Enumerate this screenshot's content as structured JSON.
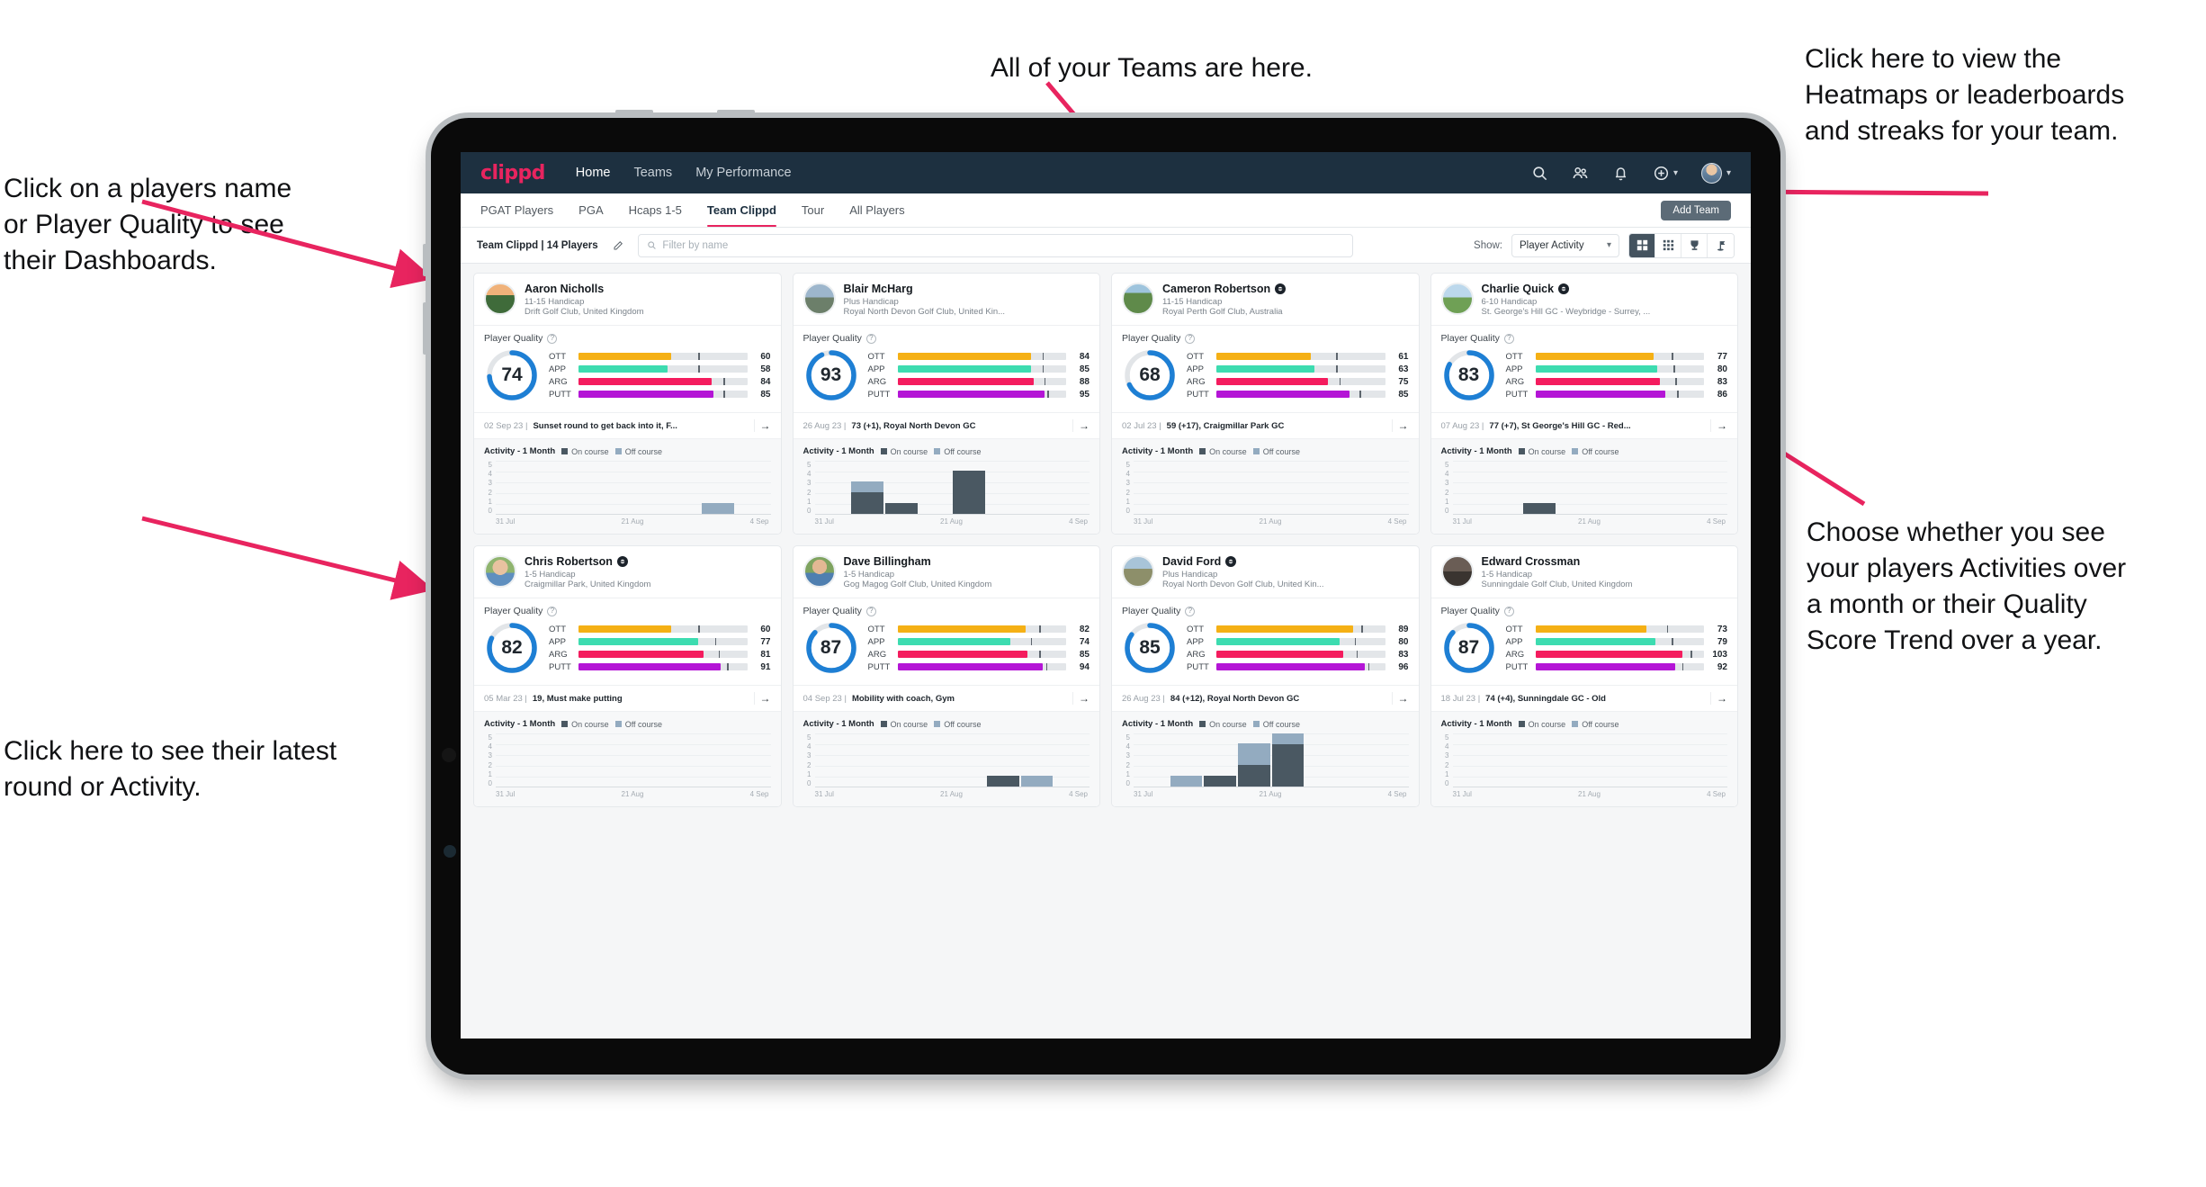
{
  "annotations": [
    {
      "id": "teams",
      "text": "All of your Teams are here."
    },
    {
      "id": "heatmaps",
      "text": "Click here to view the\nHeatmaps or leaderboards\nand streaks for your team."
    },
    {
      "id": "players-name",
      "text": "Click on a players name\nor Player Quality to see\ntheir Dashboards."
    },
    {
      "id": "activity-choice",
      "text": "Choose whether you see\nyour players Activities over\na month or their Quality\nScore Trend over a year."
    },
    {
      "id": "latest-round",
      "text": "Click here to see their latest\nround or Activity."
    }
  ],
  "app": {
    "brand": "clippd",
    "nav_links": [
      {
        "label": "Home",
        "active": true
      },
      {
        "label": "Teams",
        "active": false
      },
      {
        "label": "My Performance",
        "active": false
      }
    ],
    "nav_icons": [
      "search-icon",
      "people-icon",
      "bell-icon",
      "plus-circle-icon",
      "avatar"
    ],
    "tabs": [
      {
        "label": "PGAT Players",
        "active": false
      },
      {
        "label": "PGA",
        "active": false
      },
      {
        "label": "Hcaps 1-5",
        "active": false
      },
      {
        "label": "Team Clippd",
        "active": true
      },
      {
        "label": "Tour",
        "active": false
      },
      {
        "label": "All Players",
        "active": false
      }
    ],
    "add_team_label": "Add Team",
    "filter": {
      "team_label": "Team Clippd | 14 Players",
      "edit_icon": "pencil-icon",
      "search_placeholder": "Filter by name",
      "search_value": "",
      "show_label": "Show:",
      "show_value": "Player Activity",
      "show_options": [
        "Player Activity",
        "Quality Score Trend"
      ],
      "view_toggles": [
        {
          "name": "grid-view-icon",
          "active": true
        },
        {
          "name": "dense-grid-view-icon",
          "active": false
        },
        {
          "name": "trophy-leaderboard-icon",
          "active": false
        },
        {
          "name": "heatmap-flag-icon",
          "active": false
        }
      ]
    },
    "card_labels": {
      "quality_title": "Player Quality",
      "activity_title": "Activity - 1 Month",
      "legend_on": "On course",
      "legend_off": "Off course",
      "metric_names": [
        "OTT",
        "APP",
        "ARG",
        "PUTT"
      ],
      "y_ticks": [
        "5",
        "4",
        "3",
        "2",
        "1",
        "0"
      ],
      "x_ticks": [
        "31 Jul",
        "21 Aug",
        "4 Sep"
      ],
      "arrow": "→"
    },
    "colors": {
      "brand_pink": "#e8245f",
      "navbar": "#1d3040",
      "ott": "#f5b015",
      "app": "#3ddcb0",
      "arg": "#f41c5e",
      "putt": "#b415d6",
      "donut": "#1e7fd4",
      "on_course": "#4a5862",
      "off_course": "#93abc0"
    }
  },
  "players": [
    {
      "name": "Aaron Nicholls",
      "verified": false,
      "handicap": "11-15 Handicap",
      "club": "Drift Golf Club, United Kingdom",
      "quality_score": 74,
      "metrics": [
        {
          "label": "OTT",
          "value": 60,
          "fill": 55,
          "tick": 71,
          "color": "#f5b015"
        },
        {
          "label": "APP",
          "value": 58,
          "fill": 53,
          "tick": 71,
          "color": "#3ddcb0"
        },
        {
          "label": "ARG",
          "value": 84,
          "fill": 79,
          "tick": 86,
          "color": "#f41c5e"
        },
        {
          "label": "PUTT",
          "value": 85,
          "fill": 80,
          "tick": 86,
          "color": "#b415d6"
        }
      ],
      "latest_date": "02 Sep 23",
      "latest_text": "Sunset round to get back into it, F...",
      "activity": [
        {
          "on": 0,
          "off": 0
        },
        {
          "on": 0,
          "off": 0
        },
        {
          "on": 0,
          "off": 0
        },
        {
          "on": 0,
          "off": 0
        },
        {
          "on": 0,
          "off": 0
        },
        {
          "on": 0,
          "off": 0
        },
        {
          "on": 0,
          "off": 1
        },
        {
          "on": 0,
          "off": 0
        }
      ]
    },
    {
      "name": "Blair McHarg",
      "verified": false,
      "handicap": "Plus Handicap",
      "club": "Royal North Devon Golf Club, United Kin...",
      "quality_score": 93,
      "metrics": [
        {
          "label": "OTT",
          "value": 84,
          "fill": 79,
          "tick": 86,
          "color": "#f5b015"
        },
        {
          "label": "APP",
          "value": 85,
          "fill": 79,
          "tick": 86,
          "color": "#3ddcb0"
        },
        {
          "label": "ARG",
          "value": 88,
          "fill": 81,
          "tick": 87,
          "color": "#f41c5e"
        },
        {
          "label": "PUTT",
          "value": 95,
          "fill": 87,
          "tick": 89,
          "color": "#b415d6"
        }
      ],
      "latest_date": "26 Aug 23",
      "latest_text": "73 (+1), Royal North Devon GC",
      "activity": [
        {
          "on": 0,
          "off": 0
        },
        {
          "on": 2,
          "off": 1
        },
        {
          "on": 1,
          "off": 0
        },
        {
          "on": 0,
          "off": 0
        },
        {
          "on": 4,
          "off": 0
        },
        {
          "on": 0,
          "off": 0
        },
        {
          "on": 0,
          "off": 0
        },
        {
          "on": 0,
          "off": 0
        }
      ]
    },
    {
      "name": "Cameron Robertson",
      "verified": true,
      "handicap": "11-15 Handicap",
      "club": "Royal Perth Golf Club, Australia",
      "quality_score": 68,
      "metrics": [
        {
          "label": "OTT",
          "value": 61,
          "fill": 56,
          "tick": 71,
          "color": "#f5b015"
        },
        {
          "label": "APP",
          "value": 63,
          "fill": 58,
          "tick": 71,
          "color": "#3ddcb0"
        },
        {
          "label": "ARG",
          "value": 75,
          "fill": 66,
          "tick": 73,
          "color": "#f41c5e"
        },
        {
          "label": "PUTT",
          "value": 85,
          "fill": 79,
          "tick": 85,
          "color": "#b415d6"
        }
      ],
      "latest_date": "02 Jul 23",
      "latest_text": "59 (+17), Craigmillar Park GC",
      "activity": [
        {
          "on": 0,
          "off": 0
        },
        {
          "on": 0,
          "off": 0
        },
        {
          "on": 0,
          "off": 0
        },
        {
          "on": 0,
          "off": 0
        },
        {
          "on": 0,
          "off": 0
        },
        {
          "on": 0,
          "off": 0
        },
        {
          "on": 0,
          "off": 0
        },
        {
          "on": 0,
          "off": 0
        }
      ]
    },
    {
      "name": "Charlie Quick",
      "verified": true,
      "handicap": "6-10 Handicap",
      "club": "St. George's Hill GC - Weybridge - Surrey, ...",
      "quality_score": 83,
      "metrics": [
        {
          "label": "OTT",
          "value": 77,
          "fill": 70,
          "tick": 81,
          "color": "#f5b015"
        },
        {
          "label": "APP",
          "value": 80,
          "fill": 72,
          "tick": 82,
          "color": "#3ddcb0"
        },
        {
          "label": "ARG",
          "value": 83,
          "fill": 74,
          "tick": 83,
          "color": "#f41c5e"
        },
        {
          "label": "PUTT",
          "value": 86,
          "fill": 77,
          "tick": 84,
          "color": "#b415d6"
        }
      ],
      "latest_date": "07 Aug 23",
      "latest_text": "77 (+7), St George's Hill GC - Red...",
      "activity": [
        {
          "on": 0,
          "off": 0
        },
        {
          "on": 0,
          "off": 0
        },
        {
          "on": 1,
          "off": 0
        },
        {
          "on": 0,
          "off": 0
        },
        {
          "on": 0,
          "off": 0
        },
        {
          "on": 0,
          "off": 0
        },
        {
          "on": 0,
          "off": 0
        },
        {
          "on": 0,
          "off": 0
        }
      ]
    },
    {
      "name": "Chris Robertson",
      "verified": true,
      "handicap": "1-5 Handicap",
      "club": "Craigmillar Park, United Kingdom",
      "quality_score": 82,
      "metrics": [
        {
          "label": "OTT",
          "value": 60,
          "fill": 55,
          "tick": 71,
          "color": "#f5b015"
        },
        {
          "label": "APP",
          "value": 77,
          "fill": 71,
          "tick": 81,
          "color": "#3ddcb0"
        },
        {
          "label": "ARG",
          "value": 81,
          "fill": 74,
          "tick": 83,
          "color": "#f41c5e"
        },
        {
          "label": "PUTT",
          "value": 91,
          "fill": 84,
          "tick": 88,
          "color": "#b415d6"
        }
      ],
      "latest_date": "05 Mar 23",
      "latest_text": "19, Must make putting",
      "activity": [
        {
          "on": 0,
          "off": 0
        },
        {
          "on": 0,
          "off": 0
        },
        {
          "on": 0,
          "off": 0
        },
        {
          "on": 0,
          "off": 0
        },
        {
          "on": 0,
          "off": 0
        },
        {
          "on": 0,
          "off": 0
        },
        {
          "on": 0,
          "off": 0
        },
        {
          "on": 0,
          "off": 0
        }
      ]
    },
    {
      "name": "Dave Billingham",
      "verified": false,
      "handicap": "1-5 Handicap",
      "club": "Gog Magog Golf Club, United Kingdom",
      "quality_score": 87,
      "metrics": [
        {
          "label": "OTT",
          "value": 82,
          "fill": 76,
          "tick": 84,
          "color": "#f5b015"
        },
        {
          "label": "APP",
          "value": 74,
          "fill": 67,
          "tick": 79,
          "color": "#3ddcb0"
        },
        {
          "label": "ARG",
          "value": 85,
          "fill": 77,
          "tick": 84,
          "color": "#f41c5e"
        },
        {
          "label": "PUTT",
          "value": 94,
          "fill": 86,
          "tick": 88,
          "color": "#b415d6"
        }
      ],
      "latest_date": "04 Sep 23",
      "latest_text": "Mobility with coach, Gym",
      "activity": [
        {
          "on": 0,
          "off": 0
        },
        {
          "on": 0,
          "off": 0
        },
        {
          "on": 0,
          "off": 0
        },
        {
          "on": 0,
          "off": 0
        },
        {
          "on": 0,
          "off": 0
        },
        {
          "on": 1,
          "off": 0
        },
        {
          "on": 0,
          "off": 1
        },
        {
          "on": 0,
          "off": 0
        }
      ]
    },
    {
      "name": "David Ford",
      "verified": true,
      "handicap": "Plus Handicap",
      "club": "Royal North Devon Golf Club, United Kin...",
      "quality_score": 85,
      "metrics": [
        {
          "label": "OTT",
          "value": 89,
          "fill": 81,
          "tick": 86,
          "color": "#f5b015"
        },
        {
          "label": "APP",
          "value": 80,
          "fill": 73,
          "tick": 82,
          "color": "#3ddcb0"
        },
        {
          "label": "ARG",
          "value": 83,
          "fill": 75,
          "tick": 83,
          "color": "#f41c5e"
        },
        {
          "label": "PUTT",
          "value": 96,
          "fill": 88,
          "tick": 90,
          "color": "#b415d6"
        }
      ],
      "latest_date": "26 Aug 23",
      "latest_text": "84 (+12), Royal North Devon GC",
      "activity": [
        {
          "on": 0,
          "off": 0
        },
        {
          "on": 0,
          "off": 1
        },
        {
          "on": 1,
          "off": 0
        },
        {
          "on": 2,
          "off": 2
        },
        {
          "on": 4,
          "off": 1
        },
        {
          "on": 0,
          "off": 0
        },
        {
          "on": 0,
          "off": 0
        },
        {
          "on": 0,
          "off": 0
        }
      ]
    },
    {
      "name": "Edward Crossman",
      "verified": false,
      "handicap": "1-5 Handicap",
      "club": "Sunningdale Golf Club, United Kingdom",
      "quality_score": 87,
      "metrics": [
        {
          "label": "OTT",
          "value": 73,
          "fill": 66,
          "tick": 78,
          "color": "#f5b015"
        },
        {
          "label": "APP",
          "value": 79,
          "fill": 71,
          "tick": 81,
          "color": "#3ddcb0"
        },
        {
          "label": "ARG",
          "value": 103,
          "fill": 87,
          "tick": 92,
          "color": "#f41c5e"
        },
        {
          "label": "PUTT",
          "value": 92,
          "fill": 83,
          "tick": 87,
          "color": "#b415d6"
        }
      ],
      "latest_date": "18 Jul 23",
      "latest_text": "74 (+4), Sunningdale GC - Old",
      "activity": [
        {
          "on": 0,
          "off": 0
        },
        {
          "on": 0,
          "off": 0
        },
        {
          "on": 0,
          "off": 0
        },
        {
          "on": 0,
          "off": 0
        },
        {
          "on": 0,
          "off": 0
        },
        {
          "on": 0,
          "off": 0
        },
        {
          "on": 0,
          "off": 0
        },
        {
          "on": 0,
          "off": 0
        }
      ]
    }
  ]
}
